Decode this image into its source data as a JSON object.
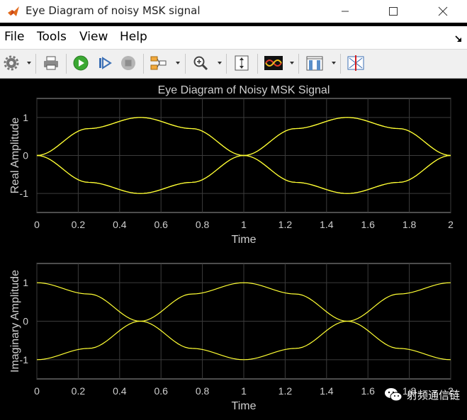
{
  "window": {
    "title": "Eye Diagram of noisy MSK signal"
  },
  "menu": {
    "items": [
      "File",
      "Tools",
      "View",
      "Help"
    ]
  },
  "toolbar": {
    "icons": [
      "settings-icon",
      "print-icon",
      "run-icon",
      "step-forward-icon",
      "stop-icon",
      "signal-routing-icon",
      "zoom-icon",
      "autoscale-icon",
      "eye-diagram-icon",
      "bar-chart-icon",
      "measurement-icon"
    ]
  },
  "colors": {
    "trace": "#ffff33",
    "grid": "#3c3c3c",
    "axes_text": "#cfcfcf",
    "background": "#000000"
  },
  "chart_data": [
    {
      "type": "line",
      "title": "Eye Diagram of Noisy MSK Signal",
      "xlabel": "Time",
      "ylabel": "Real Amplitude",
      "xlim": [
        0,
        2
      ],
      "ylim": [
        -1.5,
        1.5
      ],
      "xticks": [
        "0",
        "0.2",
        "0.4",
        "0.6",
        "0.8",
        "1",
        "1.2",
        "1.4",
        "1.6",
        "1.8",
        "2"
      ],
      "yticks": [
        "1",
        "0",
        "-1"
      ],
      "grid": true,
      "series": [
        {
          "x": [
            0,
            0.25,
            0.5,
            0.75,
            1,
            1.25,
            1.5,
            1.75,
            2
          ],
          "values": [
            0,
            0.707,
            1,
            0.707,
            0,
            0.707,
            1,
            0.707,
            0
          ]
        },
        {
          "x": [
            0,
            0.25,
            0.5,
            0.75,
            1,
            1.25,
            1.5,
            1.75,
            2
          ],
          "values": [
            0,
            -0.707,
            -1,
            -0.707,
            0,
            -0.707,
            -1,
            -0.707,
            0
          ]
        },
        {
          "x": [
            0,
            0.25,
            0.5,
            0.75,
            1,
            1.25,
            1.5,
            1.75,
            2
          ],
          "values": [
            0,
            0.707,
            1,
            0.707,
            0,
            -0.707,
            -1,
            -0.707,
            0
          ]
        },
        {
          "x": [
            0,
            0.25,
            0.5,
            0.75,
            1,
            1.25,
            1.5,
            1.75,
            2
          ],
          "values": [
            0,
            -0.707,
            -1,
            -0.707,
            0,
            0.707,
            1,
            0.707,
            0
          ]
        }
      ]
    },
    {
      "type": "line",
      "xlabel": "Time",
      "ylabel": "Imaginary Amplitude",
      "xlim": [
        0,
        2
      ],
      "ylim": [
        -1.5,
        1.5
      ],
      "xticks": [
        "0",
        "0.2",
        "0.4",
        "0.6",
        "0.8",
        "1",
        "1.2",
        "1.4",
        "1.6",
        "1.8",
        "2"
      ],
      "yticks": [
        "1",
        "0",
        "-1"
      ],
      "grid": true,
      "series": [
        {
          "x": [
            0,
            0.25,
            0.5,
            0.75,
            1,
            1.25,
            1.5,
            1.75,
            2
          ],
          "values": [
            1,
            0.707,
            0,
            -0.707,
            -1,
            -0.707,
            0,
            0.707,
            1
          ]
        },
        {
          "x": [
            0,
            0.25,
            0.5,
            0.75,
            1,
            1.25,
            1.5,
            1.75,
            2
          ],
          "values": [
            -1,
            -0.707,
            0,
            0.707,
            1,
            0.707,
            0,
            -0.707,
            -1
          ]
        }
      ]
    }
  ],
  "watermark": {
    "text": "射频通信链"
  }
}
